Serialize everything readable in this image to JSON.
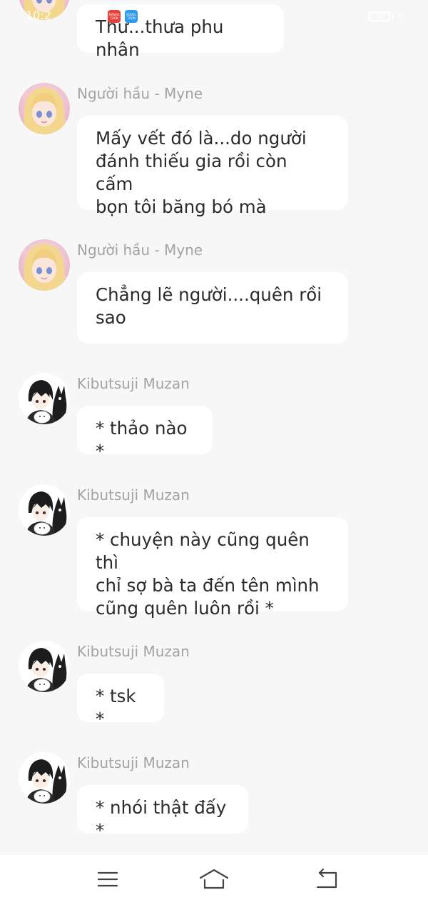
{
  "status_bar": {
    "time": "10:2",
    "app_badges": [
      {
        "text": "MANGA TOON",
        "color": "#e8413a"
      },
      {
        "text": "NOVEL TOON",
        "color": "#2f9bef"
      }
    ],
    "battery_text": "22"
  },
  "messages": [
    {
      "sender": "",
      "avatar": "girl-avatar-image",
      "text": "Thư...thưa phu nhân"
    },
    {
      "sender": "Người hầu - Myne",
      "avatar": "girl-avatar-image",
      "text": "Mấy vết đó là...do người\nđánh thiếu gia rồi còn cấm\nbọn tôi băng bó mà"
    },
    {
      "sender": "Người hầu - Myne",
      "avatar": "girl-avatar-image",
      "text": "Chẳng lẽ người....quên rồi\nsao"
    },
    {
      "sender": "Kibutsuji Muzan",
      "avatar": "boy-cat-avatar-image",
      "text": "* thảo nào *"
    },
    {
      "sender": "Kibutsuji Muzan",
      "avatar": "boy-cat-avatar-image",
      "text": "* chuyện này cũng quên thì\nchỉ sợ bà ta đến tên mình\ncũng quên luôn rồi *"
    },
    {
      "sender": "Kibutsuji Muzan",
      "avatar": "boy-cat-avatar-image",
      "text": "* tsk *"
    },
    {
      "sender": "Kibutsuji Muzan",
      "avatar": "boy-cat-avatar-image",
      "text": "* nhói thật đấy *"
    }
  ],
  "nav_bar": {
    "buttons": [
      {
        "name": "menu-icon"
      },
      {
        "name": "home-icon"
      },
      {
        "name": "back-icon"
      }
    ]
  },
  "colors": {
    "background": "#f7f7f7",
    "bubble": "#ffffff",
    "sender": "#a3a3a3",
    "text": "#2b2b2b"
  }
}
